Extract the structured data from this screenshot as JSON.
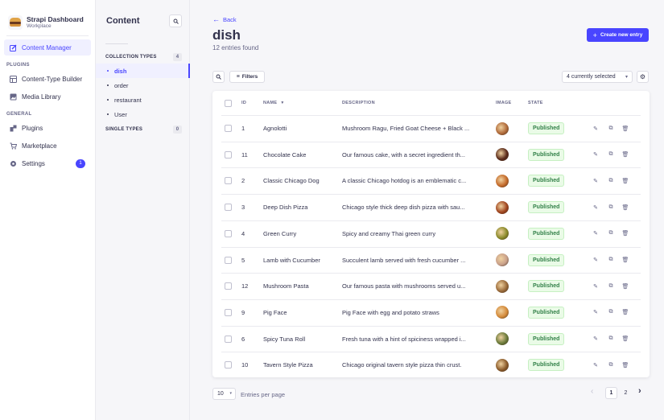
{
  "brand": {
    "title": "Strapi Dashboard",
    "subtitle": "Workplace"
  },
  "main_nav": {
    "content_manager": "Content Manager",
    "plugins_label": "PLUGINS",
    "content_type_builder": "Content-Type Builder",
    "media_library": "Media Library",
    "general_label": "GENERAL",
    "plugins": "Plugins",
    "marketplace": "Marketplace",
    "settings": "Settings",
    "settings_badge": "1"
  },
  "sub_nav": {
    "title": "Content",
    "collection_types_label": "COLLECTION TYPES",
    "collection_types_count": "4",
    "items": [
      "dish",
      "order",
      "restaurant",
      "User"
    ],
    "single_types_label": "SINGLE TYPES",
    "single_types_count": "0"
  },
  "header": {
    "back": "Back",
    "title": "dish",
    "subtitle": "12 entries found",
    "create_button": "Create new entry"
  },
  "toolbar": {
    "filters": "Filters",
    "columns_select": "4 currently selected"
  },
  "table": {
    "columns": {
      "id": "ID",
      "name": "NAME",
      "description": "DESCRIPTION",
      "image": "IMAGE",
      "state": "STATE"
    },
    "rows": [
      {
        "id": "1",
        "name": "Agnolotti",
        "description": "Mushroom Ragu, Fried Goat Cheese + Black ...",
        "state": "Published",
        "img_color": "#b06a3a"
      },
      {
        "id": "11",
        "name": "Chocolate Cake",
        "description": "Our famous cake, with a secret ingredient th...",
        "state": "Published",
        "img_color": "#5a2a1a"
      },
      {
        "id": "2",
        "name": "Classic Chicago Dog",
        "description": "A classic Chicago hotdog is an emblematic c...",
        "state": "Published",
        "img_color": "#c46a2a"
      },
      {
        "id": "3",
        "name": "Deep Dish Pizza",
        "description": "Chicago style thick deep dish pizza with sau...",
        "state": "Published",
        "img_color": "#a0441e"
      },
      {
        "id": "4",
        "name": "Green Curry",
        "description": "Spicy and creamy Thai green curry",
        "state": "Published",
        "img_color": "#8a8a2a"
      },
      {
        "id": "5",
        "name": "Lamb with Cucumber",
        "description": "Succulent lamb served with fresh cucumber ...",
        "state": "Published",
        "img_color": "#c9a08a"
      },
      {
        "id": "12",
        "name": "Mushroom Pasta",
        "description": "Our famous pasta with mushrooms served u...",
        "state": "Published",
        "img_color": "#9a6a3a"
      },
      {
        "id": "9",
        "name": "Pig Face",
        "description": "Pig Face with egg and potato straws",
        "state": "Published",
        "img_color": "#d48a3a"
      },
      {
        "id": "6",
        "name": "Spicy Tuna Roll",
        "description": "Fresh tuna with a hint of spiciness wrapped i...",
        "state": "Published",
        "img_color": "#6a7a3a"
      },
      {
        "id": "10",
        "name": "Tavern Style Pizza",
        "description": "Chicago original tavern style pizza thin crust.",
        "state": "Published",
        "img_color": "#8a5a2a"
      }
    ]
  },
  "pagination": {
    "page_size": "10",
    "label": "Entries per page",
    "pages": [
      "1",
      "2"
    ],
    "current": "1"
  },
  "colors": {
    "primary": "#4945ff",
    "success": "#328048",
    "sidebar_bg": "#ffffff",
    "page_bg": "#f6f6f9"
  }
}
